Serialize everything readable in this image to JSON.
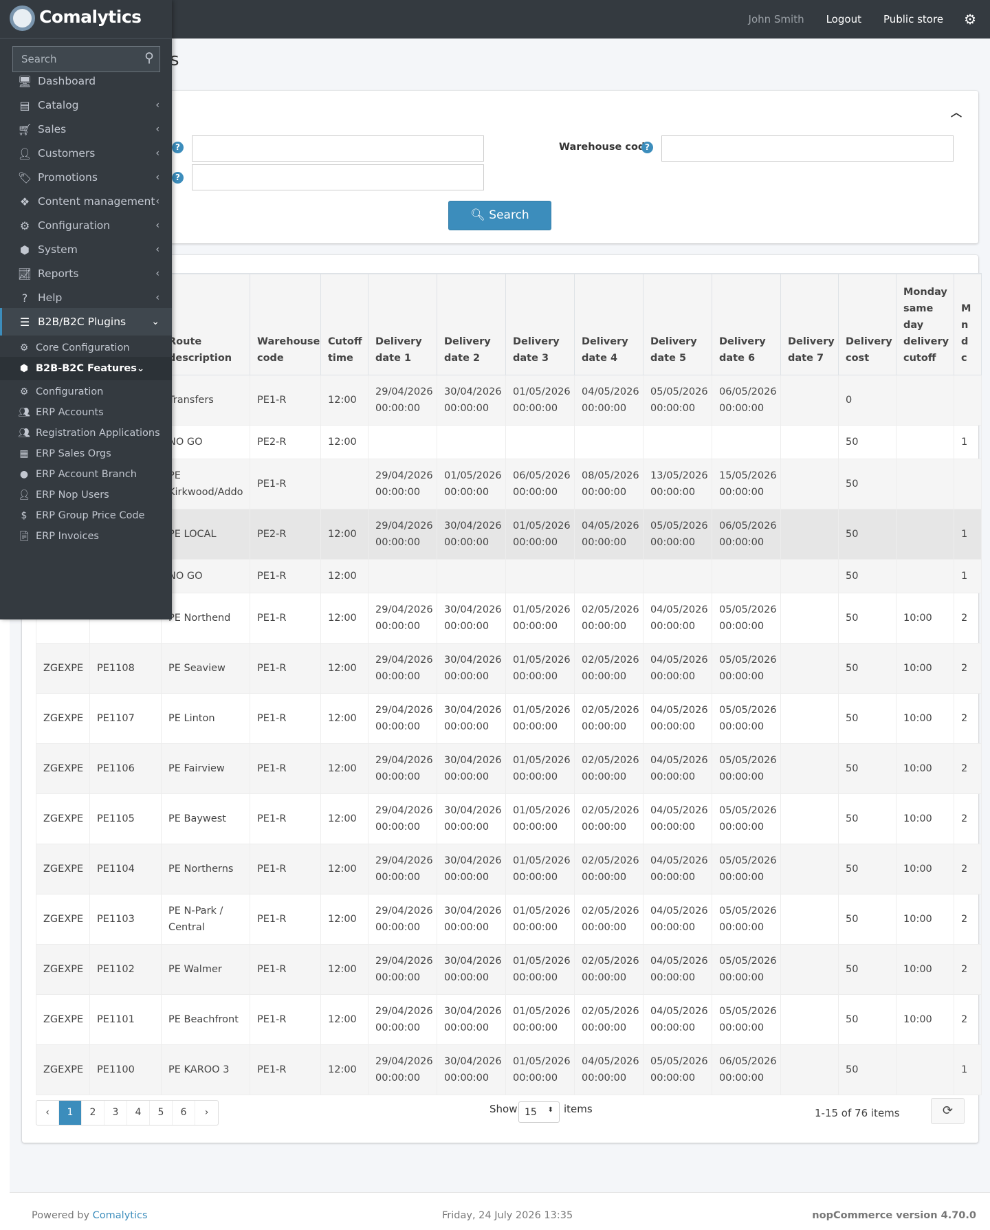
{
  "header": {
    "user_name": "John Smith",
    "logout": "Logout",
    "public_store": "Public store"
  },
  "brand": {
    "name": "Comalytics"
  },
  "sidebar": {
    "search_placeholder": "Search",
    "items": [
      {
        "label": "Dashboard",
        "icon": "monitor-icon"
      },
      {
        "label": "Catalog",
        "icon": "book-icon"
      },
      {
        "label": "Sales",
        "icon": "cart-icon"
      },
      {
        "label": "Customers",
        "icon": "user-icon"
      },
      {
        "label": "Promotions",
        "icon": "tags-icon"
      },
      {
        "label": "Content management",
        "icon": "cubes-icon"
      },
      {
        "label": "Configuration",
        "icon": "cogs-icon"
      },
      {
        "label": "System",
        "icon": "cube-icon"
      },
      {
        "label": "Reports",
        "icon": "chart-line-icon"
      },
      {
        "label": "Help",
        "icon": "question-icon"
      },
      {
        "label": "B2B/B2C Plugins",
        "icon": "bars-icon"
      }
    ],
    "plugin_items": [
      {
        "label": "Core Configuration",
        "icon": "cogs-icon"
      },
      {
        "label": "B2B-B2C Features",
        "icon": "cube-icon"
      }
    ],
    "feature_items": [
      {
        "label": "Configuration",
        "icon": "cogs-icon"
      },
      {
        "label": "ERP Accounts",
        "icon": "users-icon"
      },
      {
        "label": "Registration Applications",
        "icon": "users-icon"
      },
      {
        "label": "ERP Sales Orgs",
        "icon": "building-icon"
      },
      {
        "label": "ERP Account Branch",
        "icon": "circle-icon"
      },
      {
        "label": "ERP Nop Users",
        "icon": "user-icon"
      },
      {
        "label": "ERP Group Price Code",
        "icon": "dollar-icon"
      },
      {
        "label": "ERP Invoices",
        "icon": "file-icon"
      }
    ]
  },
  "page": {
    "title_fragment": "s"
  },
  "search_panel": {
    "warehouse_label": "Warehouse code",
    "search_button": "Search"
  },
  "table": {
    "headers": [
      "",
      "",
      "Route description",
      "Warehouse code",
      "Cutoff time",
      "Delivery date 1",
      "Delivery date 2",
      "Delivery date 3",
      "Delivery date 4",
      "Delivery date 5",
      "Delivery date 6",
      "Delivery date 7",
      "Delivery cost",
      "Monday same day delivery cutoff",
      "M n d c"
    ],
    "rows": [
      [
        "",
        "",
        "Transfers",
        "PE1-R",
        "12:00",
        "29/04/2026 00:00:00",
        "30/04/2026 00:00:00",
        "01/05/2026 00:00:00",
        "04/05/2026 00:00:00",
        "05/05/2026 00:00:00",
        "06/05/2026 00:00:00",
        "",
        "0",
        "",
        ""
      ],
      [
        "",
        "",
        "NO GO",
        "PE2-R",
        "12:00",
        "",
        "",
        "",
        "",
        "",
        "",
        "",
        "50",
        "",
        "1"
      ],
      [
        "",
        "",
        "PE Kirkwood/Addo",
        "PE1-R",
        "",
        "29/04/2026 00:00:00",
        "01/05/2026 00:00:00",
        "06/05/2026 00:00:00",
        "08/05/2026 00:00:00",
        "13/05/2026 00:00:00",
        "15/05/2026 00:00:00",
        "",
        "50",
        "",
        ""
      ],
      [
        "",
        "",
        "PE LOCAL",
        "PE2-R",
        "12:00",
        "29/04/2026 00:00:00",
        "30/04/2026 00:00:00",
        "01/05/2026 00:00:00",
        "04/05/2026 00:00:00",
        "05/05/2026 00:00:00",
        "06/05/2026 00:00:00",
        "",
        "50",
        "",
        "1"
      ],
      [
        "",
        "",
        "NO GO",
        "PE1-R",
        "12:00",
        "",
        "",
        "",
        "",
        "",
        "",
        "",
        "50",
        "",
        "1"
      ],
      [
        "",
        "",
        "PE Northend",
        "PE1-R",
        "12:00",
        "29/04/2026 00:00:00",
        "30/04/2026 00:00:00",
        "01/05/2026 00:00:00",
        "02/05/2026 00:00:00",
        "04/05/2026 00:00:00",
        "05/05/2026 00:00:00",
        "",
        "50",
        "10:00",
        "2"
      ],
      [
        "ZGEXPE",
        "PE1108",
        "PE Seaview",
        "PE1-R",
        "12:00",
        "29/04/2026 00:00:00",
        "30/04/2026 00:00:00",
        "01/05/2026 00:00:00",
        "02/05/2026 00:00:00",
        "04/05/2026 00:00:00",
        "05/05/2026 00:00:00",
        "",
        "50",
        "10:00",
        "2"
      ],
      [
        "ZGEXPE",
        "PE1107",
        "PE Linton",
        "PE1-R",
        "12:00",
        "29/04/2026 00:00:00",
        "30/04/2026 00:00:00",
        "01/05/2026 00:00:00",
        "02/05/2026 00:00:00",
        "04/05/2026 00:00:00",
        "05/05/2026 00:00:00",
        "",
        "50",
        "10:00",
        "2"
      ],
      [
        "ZGEXPE",
        "PE1106",
        "PE Fairview",
        "PE1-R",
        "12:00",
        "29/04/2026 00:00:00",
        "30/04/2026 00:00:00",
        "01/05/2026 00:00:00",
        "02/05/2026 00:00:00",
        "04/05/2026 00:00:00",
        "05/05/2026 00:00:00",
        "",
        "50",
        "10:00",
        "2"
      ],
      [
        "ZGEXPE",
        "PE1105",
        "PE Baywest",
        "PE1-R",
        "12:00",
        "29/04/2026 00:00:00",
        "30/04/2026 00:00:00",
        "01/05/2026 00:00:00",
        "02/05/2026 00:00:00",
        "04/05/2026 00:00:00",
        "05/05/2026 00:00:00",
        "",
        "50",
        "10:00",
        "2"
      ],
      [
        "ZGEXPE",
        "PE1104",
        "PE Northerns",
        "PE1-R",
        "12:00",
        "29/04/2026 00:00:00",
        "30/04/2026 00:00:00",
        "01/05/2026 00:00:00",
        "02/05/2026 00:00:00",
        "04/05/2026 00:00:00",
        "05/05/2026 00:00:00",
        "",
        "50",
        "10:00",
        "2"
      ],
      [
        "ZGEXPE",
        "PE1103",
        "PE N-Park / Central",
        "PE1-R",
        "12:00",
        "29/04/2026 00:00:00",
        "30/04/2026 00:00:00",
        "01/05/2026 00:00:00",
        "02/05/2026 00:00:00",
        "04/05/2026 00:00:00",
        "05/05/2026 00:00:00",
        "",
        "50",
        "10:00",
        "2"
      ],
      [
        "ZGEXPE",
        "PE1102",
        "PE Walmer",
        "PE1-R",
        "12:00",
        "29/04/2026 00:00:00",
        "30/04/2026 00:00:00",
        "01/05/2026 00:00:00",
        "02/05/2026 00:00:00",
        "04/05/2026 00:00:00",
        "05/05/2026 00:00:00",
        "",
        "50",
        "10:00",
        "2"
      ],
      [
        "ZGEXPE",
        "PE1101",
        "PE Beachfront",
        "PE1-R",
        "12:00",
        "29/04/2026 00:00:00",
        "30/04/2026 00:00:00",
        "01/05/2026 00:00:00",
        "02/05/2026 00:00:00",
        "04/05/2026 00:00:00",
        "05/05/2026 00:00:00",
        "",
        "50",
        "10:00",
        "2"
      ],
      [
        "ZGEXPE",
        "PE1100",
        "PE KAROO 3",
        "PE1-R",
        "12:00",
        "29/04/2026 00:00:00",
        "30/04/2026 00:00:00",
        "01/05/2026 00:00:00",
        "04/05/2026 00:00:00",
        "05/05/2026 00:00:00",
        "06/05/2026 00:00:00",
        "",
        "50",
        "",
        "1"
      ]
    ]
  },
  "pagination": {
    "pages": [
      "1",
      "2",
      "3",
      "4",
      "5",
      "6"
    ],
    "active": "1",
    "show_label": "Show",
    "page_size": "15",
    "items_label": "items",
    "count_text": "1-15 of 76 items"
  },
  "footer": {
    "powered_by": "Powered by",
    "powered_link": "Comalytics",
    "datetime": "Friday, 24 July 2026 13:35",
    "version": "nopCommerce version 4.70.0"
  },
  "colors": {
    "accent": "#3c8dbc",
    "sidebar": "#343a40",
    "topbar": "#343a40"
  }
}
